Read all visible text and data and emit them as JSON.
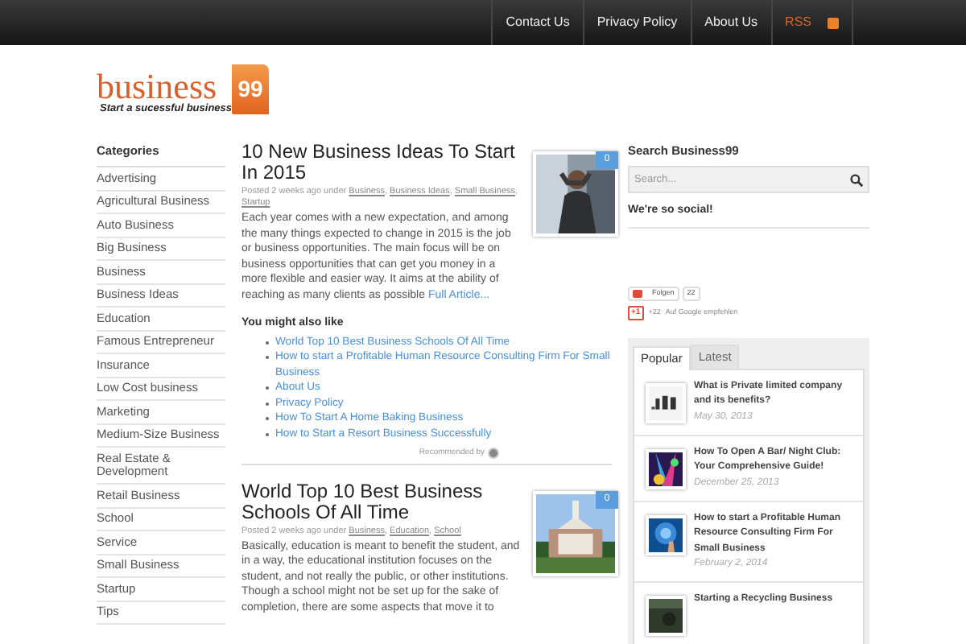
{
  "top_nav": [
    {
      "label": "Contact Us",
      "kind": "link"
    },
    {
      "label": "Privacy Policy",
      "kind": "link"
    },
    {
      "label": "About Us",
      "kind": "link"
    },
    {
      "label": "RSS",
      "kind": "rss"
    }
  ],
  "logo": {
    "name": "business",
    "number": "99",
    "tagline": "Start a sucessful business"
  },
  "categories": {
    "title": "Categories",
    "items": [
      "Advertising",
      "Agricultural Business",
      "Auto Business",
      "Big Business",
      "Business",
      "Business Ideas",
      "Education",
      "Famous Entrepreneur",
      "Insurance",
      "Low Cost business",
      "Marketing",
      "Medium-Size Business",
      "Real Estate & Development",
      "Retail Business",
      "School",
      "Service",
      "Small Business",
      "Startup",
      "Tips"
    ]
  },
  "posts": [
    {
      "title": "10 New Business Ideas To Start In 2015",
      "meta": "Posted 2 weeks ago under",
      "tags": [
        "Business",
        "Business Ideas",
        "Small Business",
        "Startup"
      ],
      "excerpt": "Each year comes with a new expectation, and among the many things expected to change in 2015 is the job or business opportunities. The main focus will be on business opportunities that can get you money in a more flexible and easier way. It aims at the ability of reaching as many clients as possible",
      "more_link": "Full Article...",
      "comment_count": "0",
      "separator": ",",
      "related": {
        "title": "You might also like",
        "items": [
          "World Top 10 Best Business Schools Of All Time",
          "How to start a Profitable Human Resource Consulting Firm For Small Business",
          "About Us",
          "Privacy Policy",
          "How To Start A Home Baking Business",
          "How to Start a Resort Business Successfully"
        ],
        "recommended": "Recommended by"
      }
    },
    {
      "title": "World Top 10 Best Business Schools Of All Time",
      "meta": "Posted 2 weeks ago under",
      "tags": [
        "Business",
        "Education",
        "School"
      ],
      "excerpt": "Basically, education is meant to benefit the student, and in a way, the educational institution focuses on the student, and not really the public, or other institutions. Though a school might not be set up for the sake of completion, there are some aspects that move it to",
      "comment_count": "0",
      "separator": ","
    }
  ],
  "search": {
    "title": "Search Business99",
    "placeholder": "Search..."
  },
  "social": {
    "title": "We're so social!",
    "follow": "Folgen",
    "follow_count": "22",
    "plus": "+1",
    "plus_count": "+22",
    "plus_label": "Auf Google empfehlen"
  },
  "tabs": [
    {
      "label": "Popular",
      "selected": true
    },
    {
      "label": "Latest",
      "selected": false
    }
  ],
  "popular": [
    {
      "title": "What is Private limited company and its benefits?",
      "date": "May 30, 2013"
    },
    {
      "title": "How To Open A Bar/ Night Club: Your Comprehensive Guide!",
      "date": "December 25, 2013"
    },
    {
      "title": "How to start a Profitable Human Resource Consulting Firm For Small Business",
      "date": "February 2, 2014"
    },
    {
      "title": "Starting a Recycling Business"
    }
  ]
}
